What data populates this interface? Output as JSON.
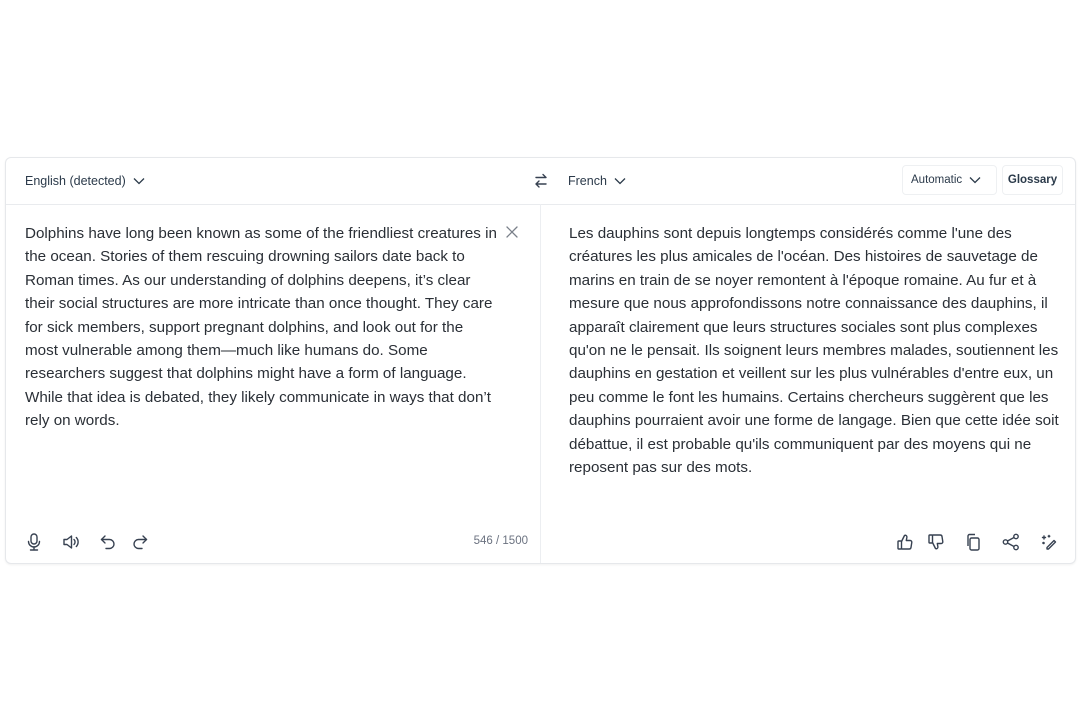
{
  "header": {
    "source_language": "English (detected)",
    "target_language": "French",
    "formality_option": "Automatic",
    "glossary_label": "Glossary"
  },
  "source": {
    "text": "Dolphins have long been known as some of the friendliest creatures in the ocean. Stories of them rescuing drowning sailors date back to Roman times. As our understanding of dolphins deepens, it’s clear their social structures are more intricate than once thought. They care for sick members, support pregnant dolphins, and look out for the most vulnerable among them—much like humans do. Some researchers suggest that dolphins might have a form of language. While that idea is debated, they likely communicate in ways that don’t rely on words.",
    "char_count": "546 / 1500"
  },
  "target": {
    "text": "Les dauphins sont depuis longtemps considérés comme l'une des créatures les plus amicales de l'océan. Des histoires de sauvetage de marins en train de se noyer remontent à l'époque romaine. Au fur et à mesure que nous approfondissons notre connaissance des dauphins, il apparaît clairement que leurs structures sociales sont plus complexes qu'on ne le pensait. Ils soignent leurs membres malades, soutiennent les dauphins en gestation et veillent sur les plus vulnérables d'entre eux, un peu comme le font les humains. Certains chercheurs suggèrent que les dauphins pourraient avoir une forme de langage. Bien que cette idée soit débattue, il est probable qu'ils communiquent par des moyens qui ne reposent pas sur des mots."
  },
  "icons": {
    "source_toolbar": [
      "microphone-icon",
      "speaker-icon",
      "undo-icon",
      "redo-icon"
    ],
    "target_toolbar": [
      "thumbs-up-icon",
      "thumbs-down-icon",
      "copy-icon",
      "share-icon",
      "magic-edit-icon"
    ]
  }
}
